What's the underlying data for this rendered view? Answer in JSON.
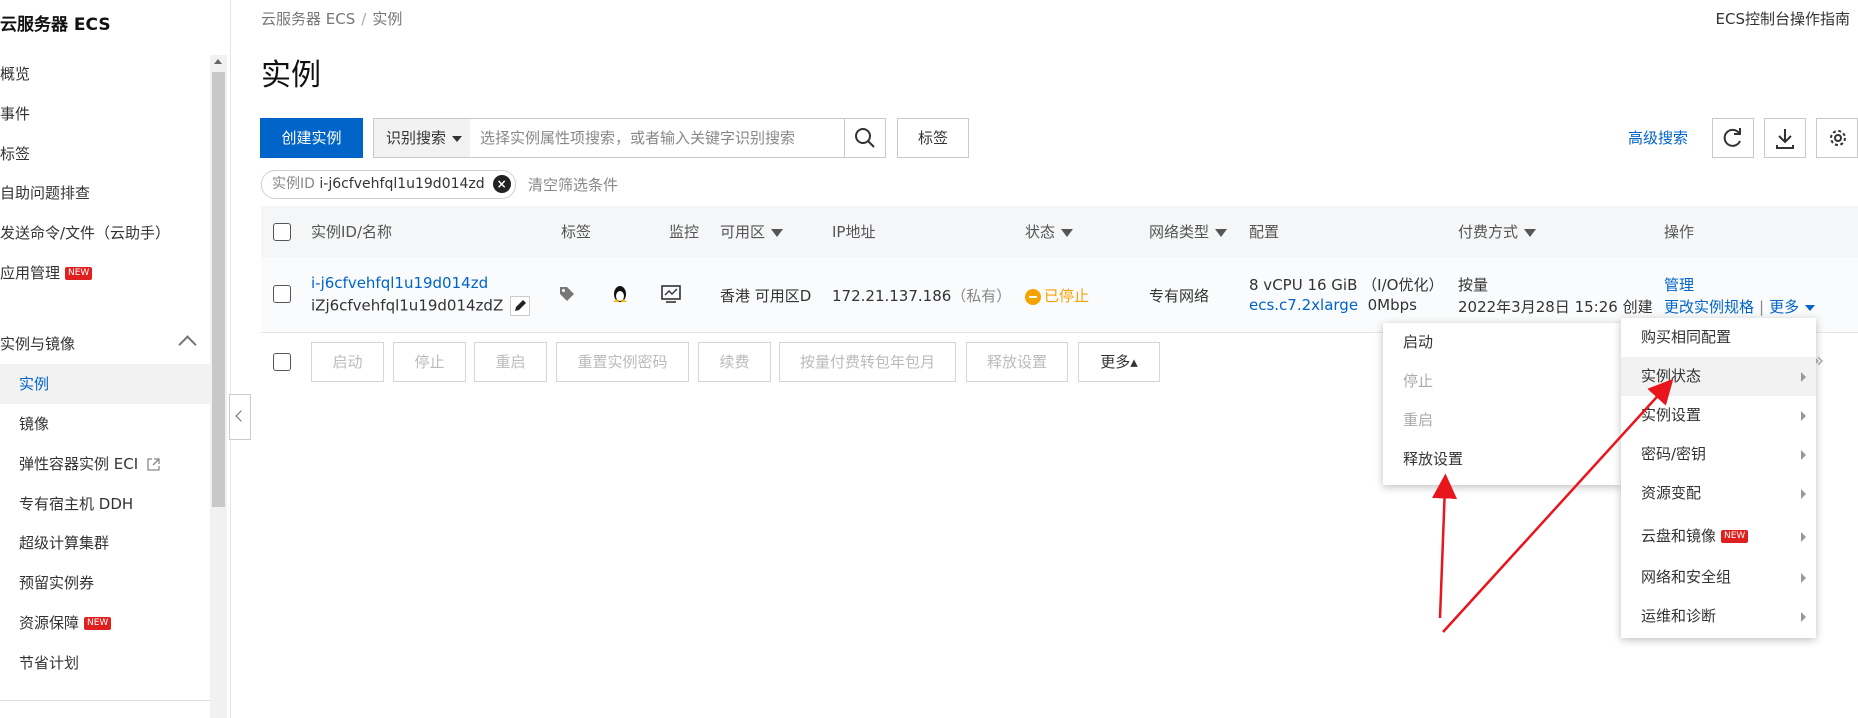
{
  "sidebar": {
    "title": "云服务器 ECS",
    "items": [
      {
        "label": "概览"
      },
      {
        "label": "事件"
      },
      {
        "label": "标签"
      },
      {
        "label": "自助问题排查"
      },
      {
        "label": "发送命令/文件（云助手）"
      },
      {
        "label": "应用管理",
        "badge": "NEW"
      }
    ],
    "group": {
      "label": "实例与镜像"
    },
    "sub_items": [
      {
        "label": "实例",
        "active": true
      },
      {
        "label": "镜像"
      },
      {
        "label": "弹性容器实例 ECI"
      },
      {
        "label": "专有宿主机 DDH"
      },
      {
        "label": "超级计算集群"
      },
      {
        "label": "预留实例券"
      },
      {
        "label": "资源保障",
        "badge": "NEW"
      },
      {
        "label": "节省计划"
      }
    ]
  },
  "header": {
    "breadcrumb": [
      "云服务器 ECS",
      "实例"
    ],
    "breadcrumb_sep": "/",
    "guide_link": "ECS控制台操作指南",
    "title": "实例"
  },
  "toolbar": {
    "create_button": "创建实例",
    "search_select": "识别搜索",
    "search_placeholder": "选择实例属性项搜索，或者输入关键字识别搜索",
    "tag_button": "标签",
    "advanced_search": "高级搜索"
  },
  "filter": {
    "chip_key": "实例ID",
    "chip_value": "i-j6cfvehfql1u19d014zd",
    "clear": "清空筛选条件"
  },
  "table": {
    "headers": {
      "id_name": "实例ID/名称",
      "tags": "标签",
      "monitor": "监控",
      "zone": "可用区",
      "ip": "IP地址",
      "status": "状态",
      "network": "网络类型",
      "config": "配置",
      "billing": "付费方式",
      "actions": "操作"
    },
    "row": {
      "instance_id": "i-j6cfvehfql1u19d014zd",
      "instance_name": "iZj6cfvehfql1u19d014zdZ",
      "zone": "香港 可用区D",
      "ip": "172.21.137.186",
      "ip_type": "（私有）",
      "status": "已停止",
      "network": "专有网络",
      "config_line1": "8 vCPU 16 GiB （I/O优化）",
      "instance_type": "ecs.c7.2xlarge",
      "bandwidth": "0Mbps",
      "billing": "按量",
      "created": "2022年3月28日 15:26 创建",
      "action_manage": "管理",
      "action_change": "更改实例规格",
      "action_sep": "|",
      "action_more": "更多"
    }
  },
  "batch": {
    "buttons": [
      "启动",
      "停止",
      "重启",
      "重置实例密码",
      "续费",
      "按量付费转包年包月",
      "释放设置"
    ],
    "more": "更多▴"
  },
  "status_menu": {
    "items": [
      {
        "label": "启动",
        "disabled": false
      },
      {
        "label": "停止",
        "disabled": true
      },
      {
        "label": "重启",
        "disabled": true
      },
      {
        "label": "释放设置",
        "disabled": false
      }
    ]
  },
  "more_menu": {
    "items": [
      {
        "label": "购买相同配置",
        "submenu": false
      },
      {
        "label": "实例状态",
        "submenu": true,
        "hover": true
      },
      {
        "label": "实例设置",
        "submenu": true
      },
      {
        "label": "密码/密钥",
        "submenu": true
      },
      {
        "label": "资源变配",
        "submenu": true
      },
      {
        "label": "云盘和镜像",
        "submenu": true,
        "badge": "NEW"
      },
      {
        "label": "网络和安全组",
        "submenu": true
      },
      {
        "label": "运维和诊断",
        "submenu": true
      }
    ]
  },
  "pager_glyph": "»",
  "colors": {
    "primary": "#0064c8",
    "stopped": "#f5a300",
    "annotation": "#e8151d",
    "badge": "#e0201e"
  }
}
